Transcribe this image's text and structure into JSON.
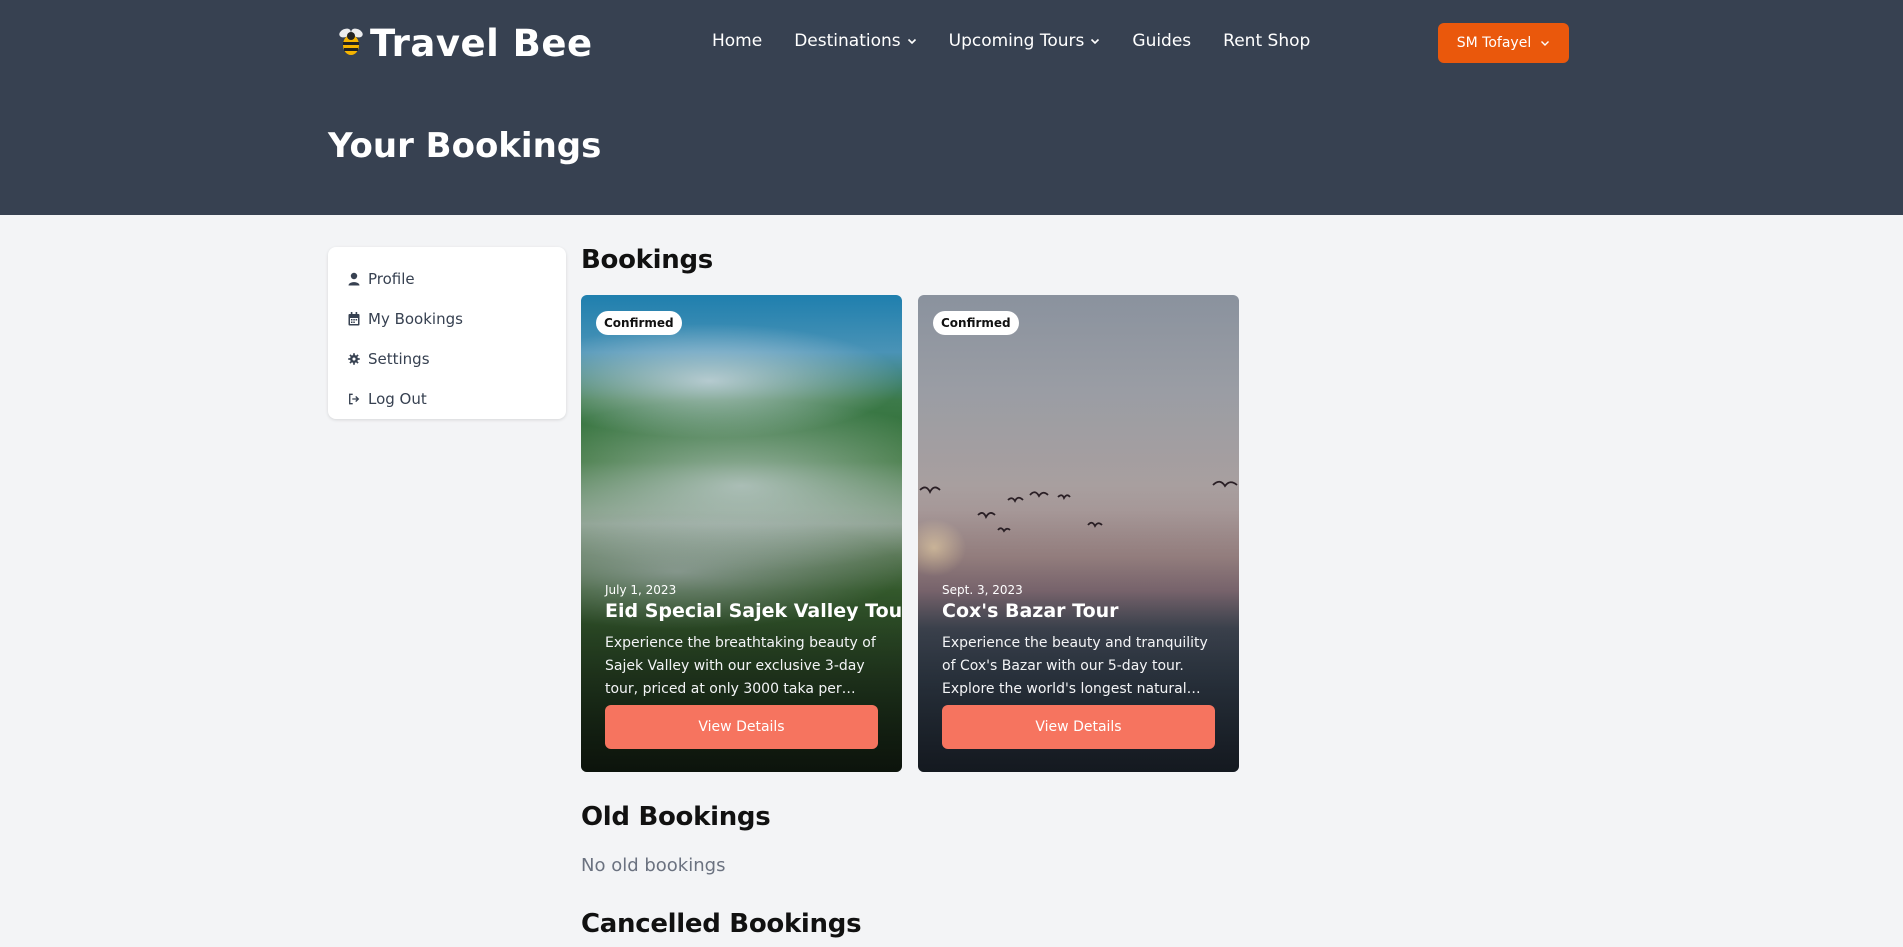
{
  "brand": {
    "name": "Travel Bee",
    "logo_icon": "bee-icon"
  },
  "nav": {
    "items": [
      {
        "label": "Home",
        "has_dropdown": false
      },
      {
        "label": "Destinations",
        "has_dropdown": true
      },
      {
        "label": "Upcoming Tours",
        "has_dropdown": true
      },
      {
        "label": "Guides",
        "has_dropdown": false
      },
      {
        "label": "Rent Shop",
        "has_dropdown": false
      }
    ],
    "user_label": "SM Tofayel"
  },
  "page": {
    "title": "Your Bookings"
  },
  "sidebar": {
    "items": [
      {
        "label": "Profile",
        "icon": "user-icon"
      },
      {
        "label": "My Bookings",
        "icon": "calendar-icon"
      },
      {
        "label": "Settings",
        "icon": "gear-icon"
      },
      {
        "label": "Log Out",
        "icon": "logout-icon"
      }
    ]
  },
  "bookings": {
    "heading": "Bookings",
    "cards": [
      {
        "status": "Confirmed",
        "date": "July 1, 2023",
        "title": "Eid Special Sajek Valley Tour",
        "description": "Experience the breathtaking beauty of Sajek Valley with our exclusive 3-day tour, priced at only 3000 taka per…",
        "button": "View Details"
      },
      {
        "status": "Confirmed",
        "date": "Sept. 3, 2023",
        "title": "Cox's Bazar Tour",
        "description": "Experience the beauty and tranquility of Cox's Bazar with our 5-day tour. Explore the world's longest natural…",
        "button": "View Details"
      }
    ]
  },
  "old_bookings": {
    "heading": "Old Bookings",
    "empty_text": "No old bookings"
  },
  "cancelled_bookings": {
    "heading": "Cancelled Bookings"
  },
  "colors": {
    "header_bg": "#374151",
    "accent": "#ea580c",
    "card_button": "#f6745f",
    "page_bg": "#f3f4f6"
  }
}
